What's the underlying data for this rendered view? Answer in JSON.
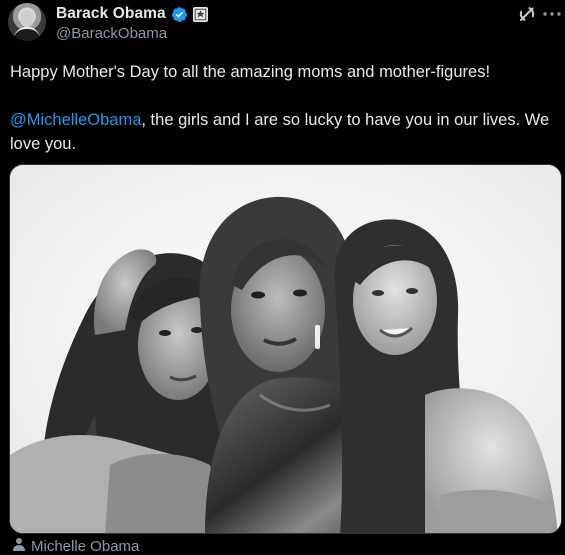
{
  "author": {
    "display_name": "Barack Obama",
    "handle": "@BarackObama",
    "verified": true,
    "affiliation_icon": "government-seal-icon"
  },
  "header_actions": {
    "grok_icon": "grok-icon",
    "more_icon": "more-icon"
  },
  "tweet": {
    "line1": "Happy Mother's Day to all the amazing moms and mother-figures!",
    "mention": "@MichelleObama",
    "line2_rest": ", the girls and I are so lucky to have you in our lives. We love you."
  },
  "media": {
    "type": "photo",
    "style": "black-and-white portrait of three women"
  },
  "tagged": {
    "icon": "person-icon",
    "name": "Michelle Obama"
  },
  "colors": {
    "background": "#000000",
    "text": "#e7e9ea",
    "secondary_text": "#8b98a5",
    "link": "#1d9bf0",
    "verified_badge": "#1d9bf0"
  }
}
